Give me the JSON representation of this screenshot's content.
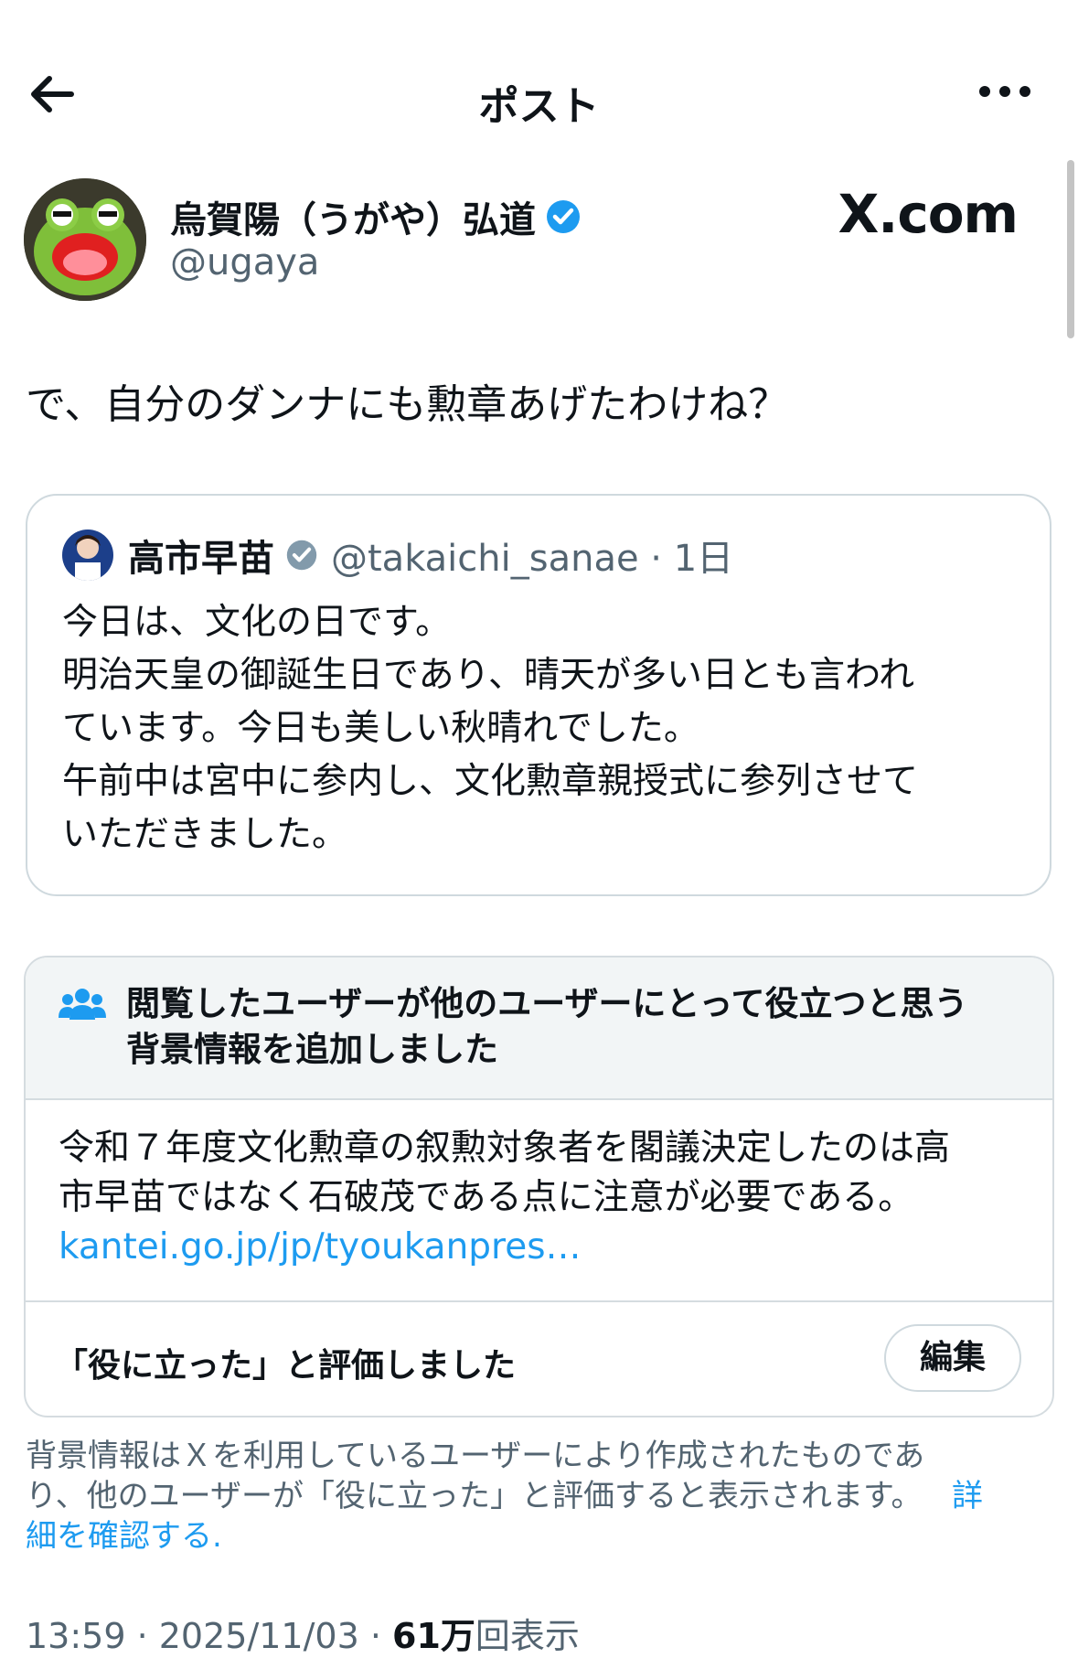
{
  "header": {
    "title": "ポスト",
    "back_icon": "arrow-left-icon",
    "more_icon": "more-horizontal-icon"
  },
  "post": {
    "author_name": "烏賀陽（うがや）弘道",
    "handle": "@ugaya",
    "verified_color": "#1d9bf0",
    "watermark": "X.com",
    "text": "で、自分のダンナにも勲章あげたわけね？"
  },
  "quote": {
    "author_name": "高市早苗",
    "handle_time": "@takaichi_sanae · 1日",
    "verified_color": "#829aab",
    "lines": [
      "今日は、文化の日です。",
      "明治天皇の御誕生日であり、晴天が多い日とも言われ",
      "ています。今日も美しい秋晴れでした。",
      "午前中は宮中に参内し、文化勲章親授式に参列させて",
      "いただきました。"
    ]
  },
  "note": {
    "heading_line1": "閲覧したユーザーが他のユーザーにとって役立つと思う",
    "heading_line2": "背景情報を追加しました",
    "body_line1": "令和７年度文化勲章の叙勲対象者を閣議決定したのは高",
    "body_line2": "市早苗ではなく石破茂である点に注意が必要である。",
    "link": "kantei.go.jp/jp/tyoukanpres…",
    "rated_text": "「役に立った」と評価しました",
    "edit_label": "編集",
    "accent_color": "#1d9bf0"
  },
  "disclaimer": {
    "line1": "背景情報はＸを利用しているユーザーにより作成されたものであ",
    "line2": "り、他のユーザーが「役に立った」と評価すると表示されます。",
    "link_part1": "詳",
    "link_part2": "細を確認する",
    "period": "."
  },
  "meta": {
    "time_date": "13:59 · 2025/11/03 · ",
    "views_count": "61万",
    "views_label": "回表示"
  }
}
